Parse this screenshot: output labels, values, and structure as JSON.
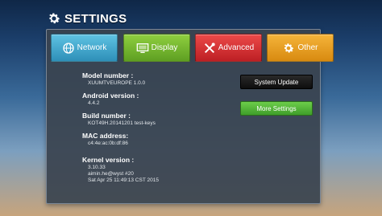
{
  "header": {
    "title": "SETTINGS",
    "icon": "gear-icon"
  },
  "tabs": [
    {
      "label": "Network",
      "icon": "network-icon",
      "color": "#3ba5cc"
    },
    {
      "label": "Display",
      "icon": "display-icon",
      "color": "#72b72e"
    },
    {
      "label": "Advanced",
      "icon": "tools-icon",
      "color": "#d42f32"
    },
    {
      "label": "Other",
      "icon": "gear-icon",
      "color": "#e89d20"
    }
  ],
  "info": {
    "model_label": "Model number :",
    "model_value": "XUUMTVEUROPE 1.0.0",
    "android_label": "Android version :",
    "android_value": "4.4.2",
    "build_label": "Build number :",
    "build_value": "KOT49H.20141201 test-keys",
    "mac_label": "MAC address:",
    "mac_value": "c4:4e:ac:0b:df:86",
    "kernel_label": "Kernel version :",
    "kernel_lines": [
      "3.10.33",
      "aimin.he@wyst #20",
      "Sat Apr 25 11:49:13 CST 2015"
    ]
  },
  "buttons": {
    "system_update": "System Update",
    "more_settings": "More Settings"
  }
}
